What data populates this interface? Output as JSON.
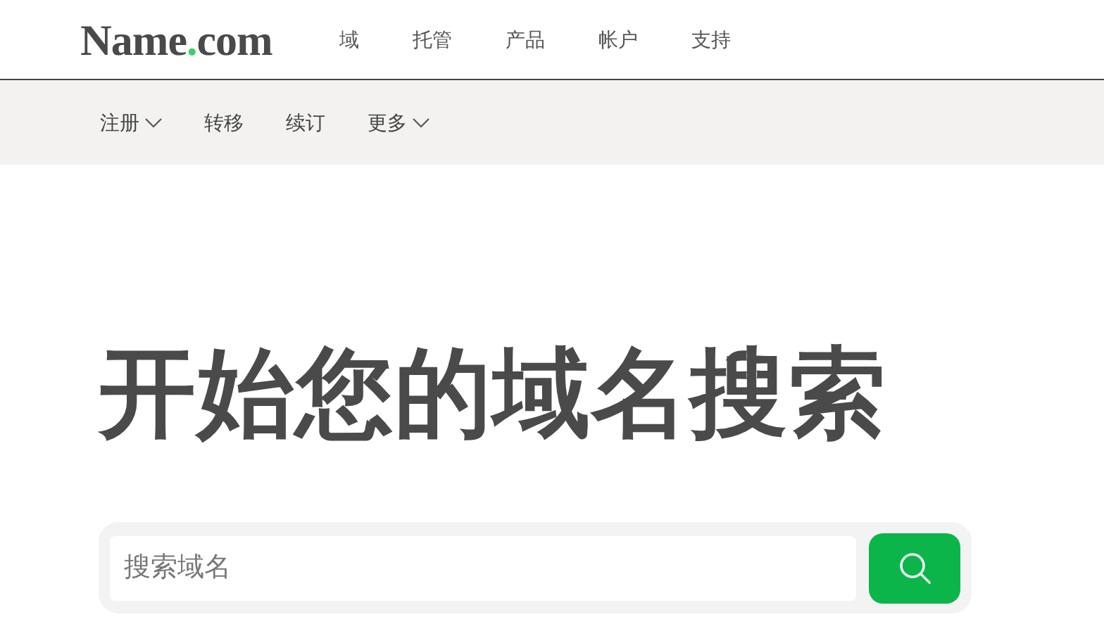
{
  "logo": [
    {
      "text": "Name",
      "accent": false
    },
    {
      "text": ".",
      "accent": true
    },
    {
      "text": "com",
      "accent": false
    }
  ],
  "main_nav": [
    "域",
    "托管",
    "产品",
    "帐户",
    "支持"
  ],
  "sub_nav": [
    {
      "label": "注册",
      "dropdown": true
    },
    {
      "label": "转移",
      "dropdown": false
    },
    {
      "label": "续订",
      "dropdown": false
    },
    {
      "label": "更多",
      "dropdown": true
    }
  ],
  "headline": "开始您的域名搜索",
  "search": {
    "placeholder": "搜索域名"
  }
}
